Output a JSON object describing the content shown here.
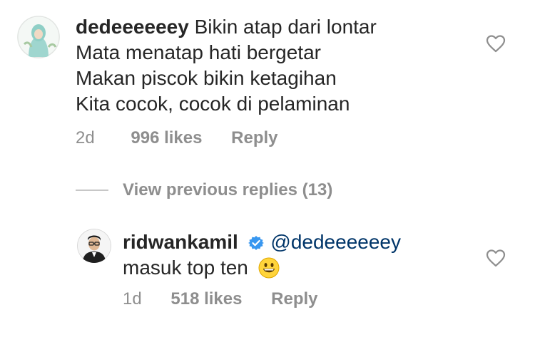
{
  "comments": [
    {
      "username": "dedeeeeeey",
      "lines": [
        "Bikin atap dari lontar",
        "Mata menatap hati bergetar",
        "Makan piscok bikin ketagihan",
        "Kita cocok, cocok di pelaminan"
      ],
      "time": "2d",
      "likes": "996 likes",
      "reply_label": "Reply",
      "avatar_icon": "avatar-hijab-woman",
      "like_icon": "heart-outline-icon"
    }
  ],
  "view_previous_replies": "View previous replies (13)",
  "replies": [
    {
      "username": "ridwankamil",
      "verified": true,
      "verified_icon": "verified-badge-icon",
      "mention": "@dedeeeeeey",
      "text": "masuk top ten",
      "emoji": "😀",
      "time": "1d",
      "likes": "518 likes",
      "reply_label": "Reply",
      "avatar_icon": "avatar-man-glasses",
      "like_icon": "heart-outline-icon"
    }
  ],
  "colors": {
    "text": "#262626",
    "meta": "#8e8e8e",
    "mention": "#003569",
    "verified": "#3897f0",
    "divider": "#c7c7c7"
  }
}
